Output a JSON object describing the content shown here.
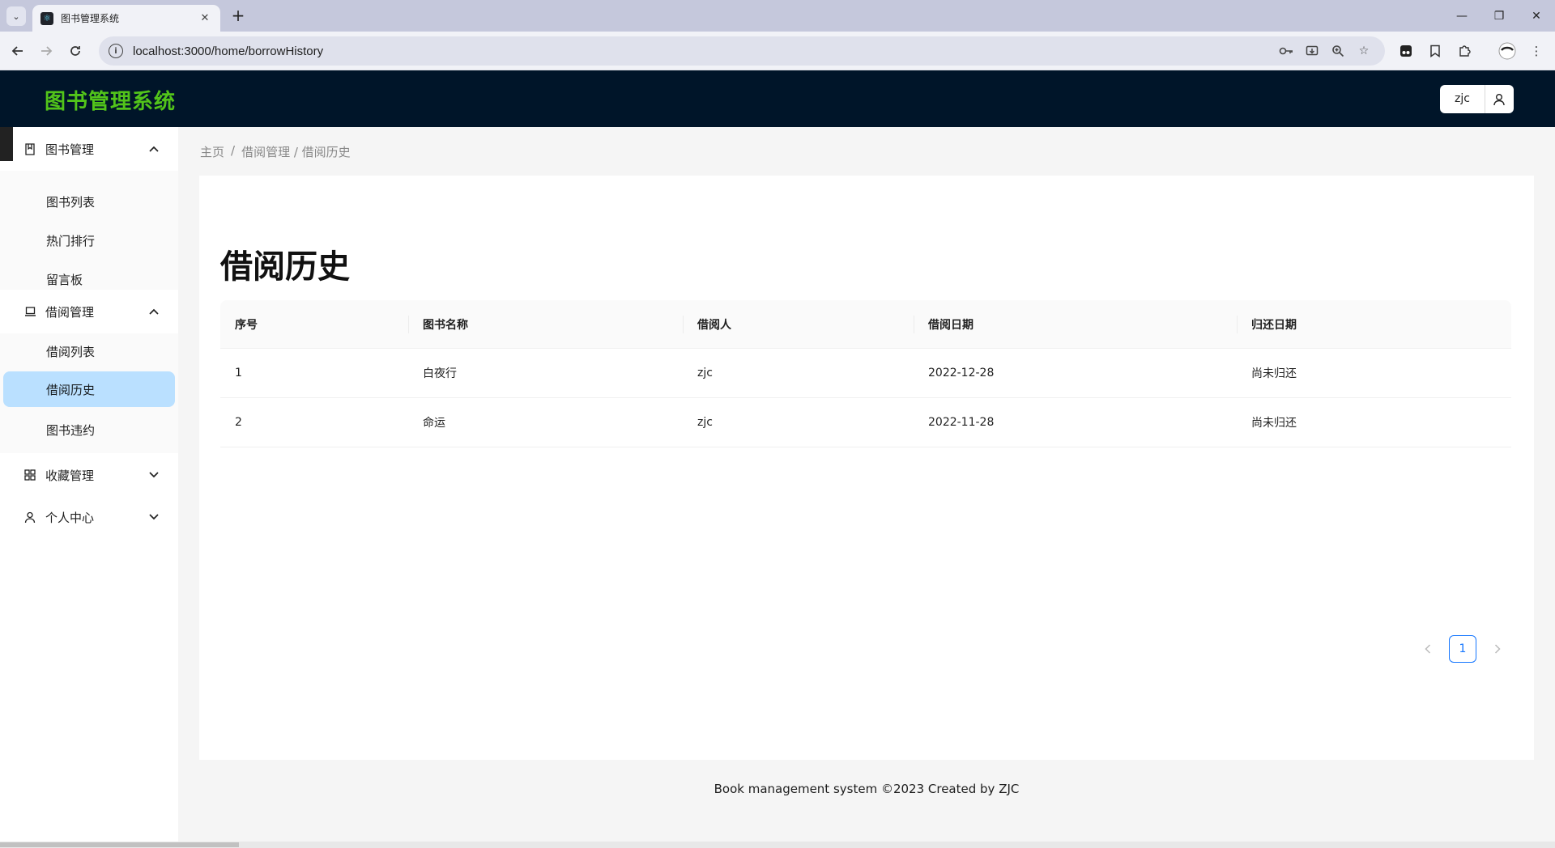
{
  "browser": {
    "tab_title": "图书管理系统",
    "url": "localhost:3000/home/borrowHistory"
  },
  "header": {
    "logo": "图书管理系统",
    "username": "zjc"
  },
  "sidebar": {
    "groups": [
      {
        "label": "图书管理",
        "icon": "book-icon",
        "expanded": true,
        "items": [
          {
            "label": "图书列表"
          },
          {
            "label": "热门排行"
          },
          {
            "label": "留言板"
          }
        ]
      },
      {
        "label": "借阅管理",
        "icon": "laptop-icon",
        "expanded": true,
        "items": [
          {
            "label": "借阅列表"
          },
          {
            "label": "借阅历史",
            "active": true
          },
          {
            "label": "图书违约"
          }
        ]
      },
      {
        "label": "收藏管理",
        "icon": "appstore-icon",
        "expanded": false
      },
      {
        "label": "个人中心",
        "icon": "user-icon",
        "expanded": false
      }
    ]
  },
  "breadcrumb": {
    "home": "主页",
    "separator": "/",
    "current": "借阅管理 / 借阅历史"
  },
  "main": {
    "title": "借阅历史",
    "table": {
      "columns": [
        "序号",
        "图书名称",
        "借阅人",
        "借阅日期",
        "归还日期"
      ],
      "rows": [
        [
          "1",
          "白夜行",
          "zjc",
          "2022-12-28",
          "尚未归还"
        ],
        [
          "2",
          "命运",
          "zjc",
          "2022-11-28",
          "尚未归还"
        ]
      ]
    },
    "pagination": {
      "current_page": "1"
    }
  },
  "footer": {
    "text": "Book management system ©2023 Created by ZJC"
  },
  "colors": {
    "header_bg": "#001529",
    "logo": "#52c41a",
    "active_item_bg": "#bae0ff",
    "primary": "#1677ff"
  }
}
